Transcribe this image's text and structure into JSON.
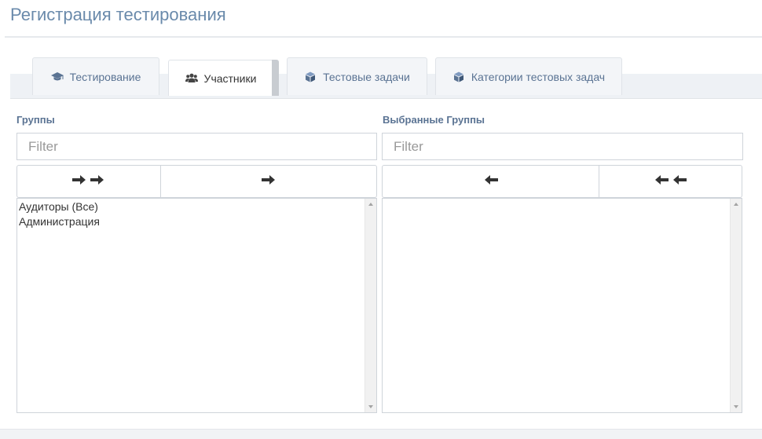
{
  "page": {
    "title": "Регистрация тестирования"
  },
  "tabs": [
    {
      "label": "Тестирование",
      "icon": "graduation-cap-icon",
      "active": false
    },
    {
      "label": "Участники",
      "icon": "users-icon",
      "active": true
    },
    {
      "label": "Тестовые задачи",
      "icon": "cube-icon",
      "active": false
    },
    {
      "label": "Категории тестовых задач",
      "icon": "cube-icon",
      "active": false
    }
  ],
  "available": {
    "label": "Группы",
    "filter_placeholder": "Filter",
    "buttons": [
      "move-all-right",
      "move-selected-right"
    ],
    "items": [
      "Аудиторы (Все)",
      "Администрация"
    ]
  },
  "selected": {
    "label": "Выбранные Группы",
    "filter_placeholder": "Filter",
    "buttons": [
      "move-selected-left",
      "move-all-left"
    ],
    "items": []
  },
  "colors": {
    "accent": "#5a7393",
    "title": "#6a8aab",
    "border": "#cfd4da"
  }
}
